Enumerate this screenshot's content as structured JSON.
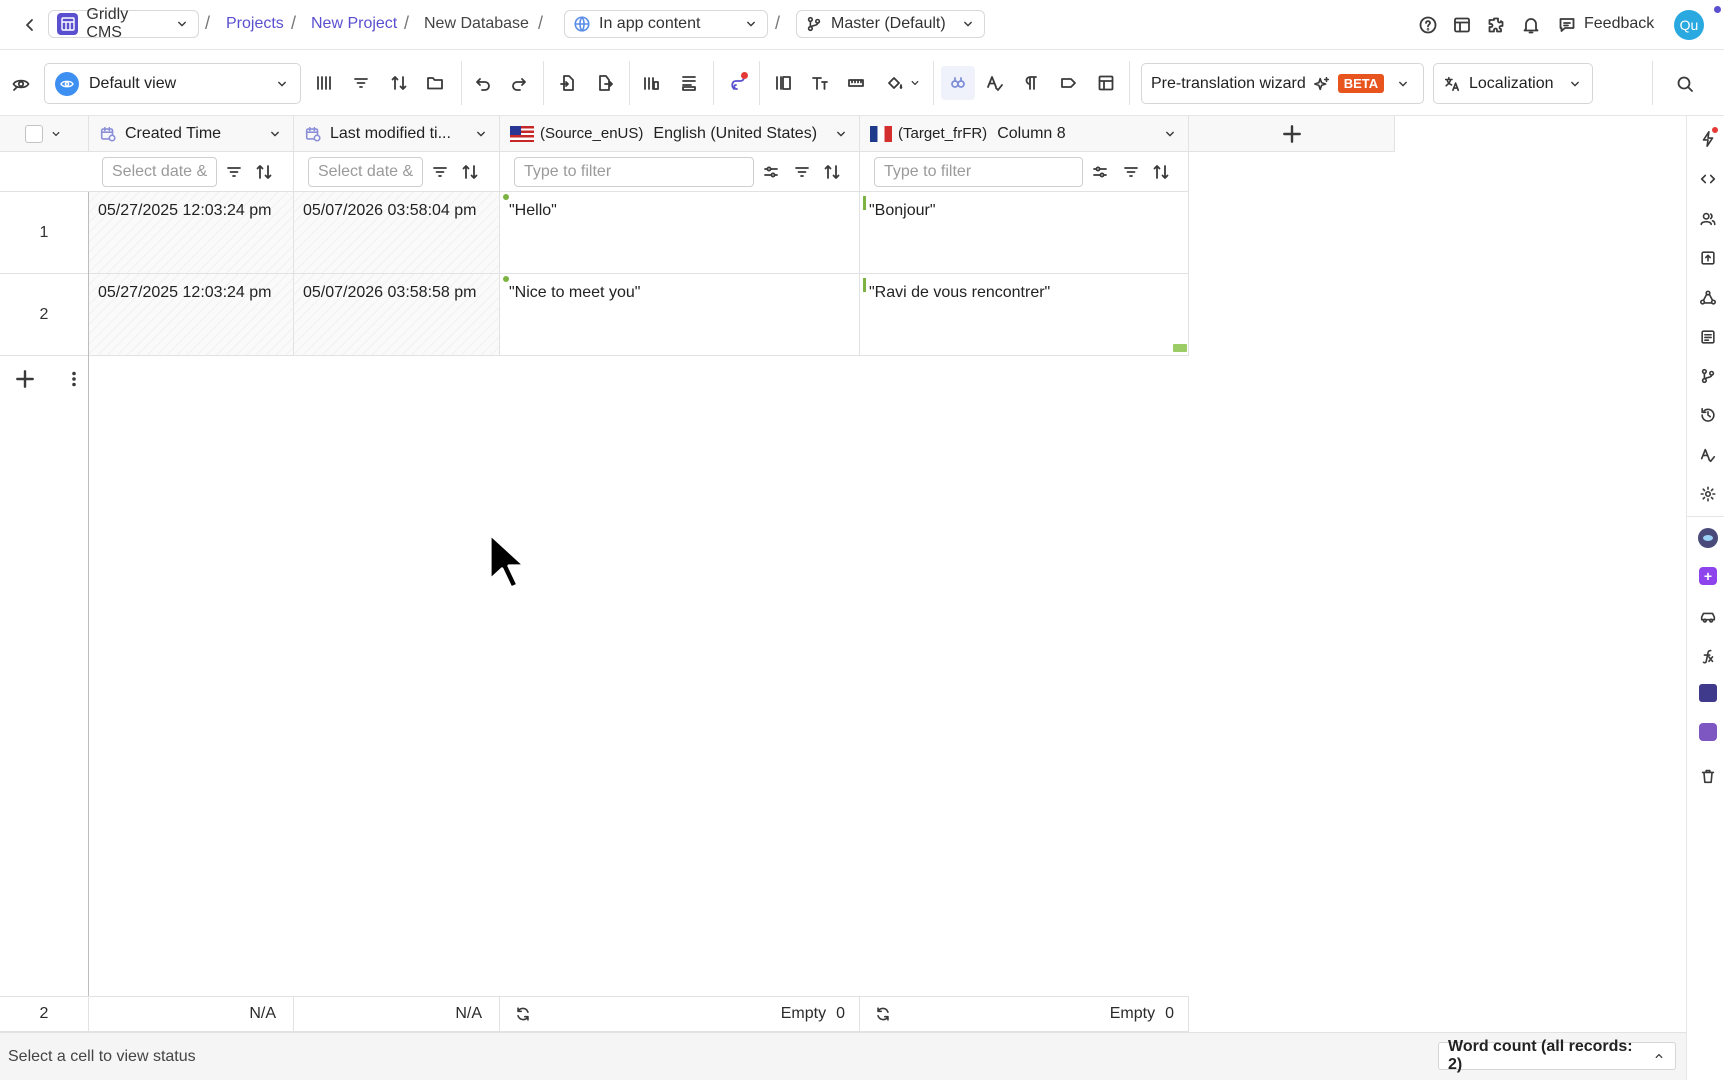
{
  "breadcrumb": {
    "app": "Gridly CMS",
    "projects": "Projects",
    "project": "New Project",
    "database": "New Database",
    "grid": "In app content",
    "branch": "Master (Default)"
  },
  "header": {
    "feedback": "Feedback",
    "avatar": "Qu"
  },
  "toolbar": {
    "view": "Default view",
    "pretranslation": "Pre-translation wizard",
    "beta": "BETA",
    "localization": "Localization"
  },
  "columns": [
    {
      "tag": "",
      "title": "Created Time",
      "filter_placeholder": "Select date &"
    },
    {
      "tag": "",
      "title": "Last modified ti...",
      "filter_placeholder": "Select date &"
    },
    {
      "tag": "(Source_enUS)",
      "title": "English (United States)",
      "filter_placeholder": "Type to filter"
    },
    {
      "tag": "(Target_frFR)",
      "title": "Column 8",
      "filter_placeholder": "Type to filter"
    }
  ],
  "rows": [
    {
      "num": "1",
      "created": "05/27/2025  12:03:24 pm",
      "modified": "05/07/2026  03:58:04 pm",
      "source": "\"Hello\"",
      "target": "\"Bonjour\""
    },
    {
      "num": "2",
      "created": "05/27/2025  12:03:24 pm",
      "modified": "05/07/2026  03:58:58 pm",
      "source": "\"Nice to meet you\"",
      "target": "\"Ravi de vous rencontrer\""
    }
  ],
  "footer": {
    "count": "2",
    "created": "N/A",
    "modified": "N/A",
    "source_empty": "Empty",
    "source_empty_count": "0",
    "target_empty": "Empty",
    "target_empty_count": "0"
  },
  "status": {
    "message": "Select a cell to view status",
    "word_count": "Word count (all records: 2)"
  },
  "colors": {
    "accent": "#5a4fcf",
    "beta": "#e8541e",
    "view_icon": "#3d8ff2",
    "status_dot": "#7cb342"
  }
}
